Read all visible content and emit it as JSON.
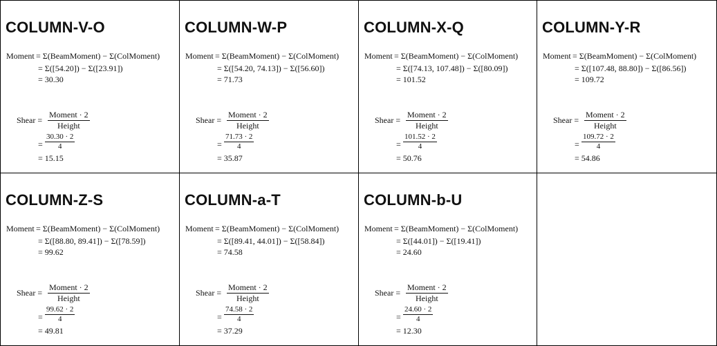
{
  "cells": [
    {
      "title": "COLUMN-V-O",
      "moment_label": "Moment",
      "moment_line1": "= Σ(BeamMoment) − Σ(ColMoment)",
      "moment_line2": "= Σ([54.20]) − Σ([23.91])",
      "moment_line3": "= 30.30",
      "shear_label": "Shear =",
      "shear_num": "Moment · 2",
      "shear_den": "Height",
      "shear_eq": "=",
      "shear_num2": "30.30 · 2",
      "shear_den2": "4",
      "shear_result": "= 15.15"
    },
    {
      "title": "COLUMN-W-P",
      "moment_label": "Moment",
      "moment_line1": "= Σ(BeamMoment) − Σ(ColMoment)",
      "moment_line2": "= Σ([54.20, 74.13]) − Σ([56.60])",
      "moment_line3": "= 71.73",
      "shear_label": "Shear =",
      "shear_num": "Moment · 2",
      "shear_den": "Height",
      "shear_eq": "=",
      "shear_num2": "71.73 · 2",
      "shear_den2": "4",
      "shear_result": "= 35.87"
    },
    {
      "title": "COLUMN-X-Q",
      "moment_label": "Moment",
      "moment_line1": "= Σ(BeamMoment) − Σ(ColMoment)",
      "moment_line2": "= Σ([74.13, 107.48]) − Σ([80.09])",
      "moment_line3": "= 101.52",
      "shear_label": "Shear =",
      "shear_num": "Moment · 2",
      "shear_den": "Height",
      "shear_eq": "=",
      "shear_num2": "101.52 · 2",
      "shear_den2": "4",
      "shear_result": "= 50.76"
    },
    {
      "title": "COLUMN-Y-R",
      "moment_label": "Moment",
      "moment_line1": "= Σ(BeamMoment) − Σ(ColMoment)",
      "moment_line2": "= Σ([107.48, 88.80]) − Σ([86.56])",
      "moment_line3": "= 109.72",
      "shear_label": "Shear =",
      "shear_num": "Moment · 2",
      "shear_den": "Height",
      "shear_eq": "=",
      "shear_num2": "109.72 · 2",
      "shear_den2": "4",
      "shear_result": "= 54.86"
    },
    {
      "title": "COLUMN-Z-S",
      "moment_label": "Moment",
      "moment_line1": "= Σ(BeamMoment) − Σ(ColMoment)",
      "moment_line2": "= Σ([88.80, 89.41]) − Σ([78.59])",
      "moment_line3": "= 99.62",
      "shear_label": "Shear =",
      "shear_num": "Moment · 2",
      "shear_den": "Height",
      "shear_eq": "=",
      "shear_num2": "99.62 · 2",
      "shear_den2": "4",
      "shear_result": "= 49.81"
    },
    {
      "title": "COLUMN-a-T",
      "moment_label": "Moment",
      "moment_line1": "= Σ(BeamMoment) − Σ(ColMoment)",
      "moment_line2": "= Σ([89.41, 44.01]) − Σ([58.84])",
      "moment_line3": "= 74.58",
      "shear_label": "Shear =",
      "shear_num": "Moment · 2",
      "shear_den": "Height",
      "shear_eq": "=",
      "shear_num2": "74.58 · 2",
      "shear_den2": "4",
      "shear_result": "= 37.29"
    },
    {
      "title": "COLUMN-b-U",
      "moment_label": "Moment",
      "moment_line1": "= Σ(BeamMoment) − Σ(ColMoment)",
      "moment_line2": "= Σ([44.01]) − Σ([19.41])",
      "moment_line3": "= 24.60",
      "shear_label": "Shear =",
      "shear_num": "Moment · 2",
      "shear_den": "Height",
      "shear_eq": "=",
      "shear_num2": "24.60 · 2",
      "shear_den2": "4",
      "shear_result": "= 12.30"
    }
  ]
}
